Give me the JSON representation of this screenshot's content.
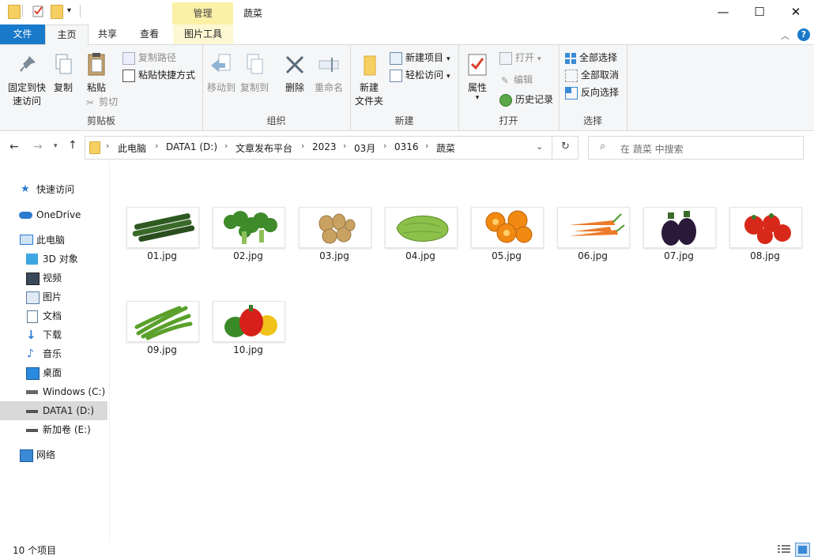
{
  "window": {
    "title": "蔬菜",
    "manage_label": "管理",
    "controls": {
      "minimize": "—",
      "maximize": "☐",
      "close": "✕"
    }
  },
  "tabs": {
    "file": "文件",
    "home": "主页",
    "share": "共享",
    "view": "查看",
    "picture_tools": "图片工具"
  },
  "ribbon": {
    "clipboard": {
      "label": "剪贴板",
      "pin": [
        "固定到快",
        "速访问"
      ],
      "copy": "复制",
      "paste": "粘贴",
      "copy_path": "复制路径",
      "paste_shortcut": "粘贴快捷方式",
      "cut": "剪切"
    },
    "organize": {
      "label": "组织",
      "move_to": "移动到",
      "copy_to": "复制到",
      "delete": "删除",
      "rename": "重命名"
    },
    "new": {
      "label": "新建",
      "new_folder": [
        "新建",
        "文件夹"
      ],
      "new_item": "新建项目",
      "easy_access": "轻松访问"
    },
    "open": {
      "label": "打开",
      "properties": "属性",
      "open": "打开",
      "edit": "编辑",
      "history": "历史记录"
    },
    "select": {
      "label": "选择",
      "select_all": "全部选择",
      "select_none": "全部取消",
      "invert": "反向选择"
    }
  },
  "address": {
    "breadcrumbs": [
      "此电脑",
      "DATA1 (D:)",
      "文章发布平台",
      "2023",
      "03月",
      "0316",
      "蔬菜"
    ],
    "search_placeholder": "在 蔬菜 中搜索"
  },
  "nav": {
    "quick_access": "快速访问",
    "onedrive": "OneDrive",
    "this_pc": "此电脑",
    "objects3d": "3D 对象",
    "videos": "视频",
    "pictures": "图片",
    "documents": "文档",
    "downloads": "下载",
    "music": "音乐",
    "desktop": "桌面",
    "drive_c": "Windows (C:)",
    "drive_d": "DATA1 (D:)",
    "drive_e": "新加卷 (E:)",
    "network": "网络"
  },
  "files": [
    {
      "name": "01.jpg",
      "icon": "cucumber"
    },
    {
      "name": "02.jpg",
      "icon": "broccoli"
    },
    {
      "name": "03.jpg",
      "icon": "potato"
    },
    {
      "name": "04.jpg",
      "icon": "chayote"
    },
    {
      "name": "05.jpg",
      "icon": "pumpkin"
    },
    {
      "name": "06.jpg",
      "icon": "carrot"
    },
    {
      "name": "07.jpg",
      "icon": "eggplant"
    },
    {
      "name": "08.jpg",
      "icon": "tomato"
    },
    {
      "name": "09.jpg",
      "icon": "green-bean"
    },
    {
      "name": "10.jpg",
      "icon": "bell-pepper"
    }
  ],
  "status": {
    "count": "10 个项目"
  },
  "colors": {
    "accent": "#1979ca",
    "manage_tab": "#fbf0a6",
    "folder": "#f5cf61"
  }
}
